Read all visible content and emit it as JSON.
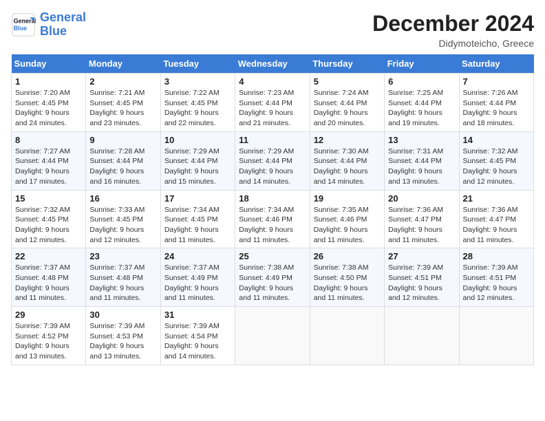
{
  "header": {
    "logo_line1": "General",
    "logo_line2": "Blue",
    "title": "December 2024",
    "subtitle": "Didymoteicho, Greece"
  },
  "weekdays": [
    "Sunday",
    "Monday",
    "Tuesday",
    "Wednesday",
    "Thursday",
    "Friday",
    "Saturday"
  ],
  "weeks": [
    [
      {
        "day": "1",
        "sunrise": "Sunrise: 7:20 AM",
        "sunset": "Sunset: 4:45 PM",
        "daylight": "Daylight: 9 hours and 24 minutes."
      },
      {
        "day": "2",
        "sunrise": "Sunrise: 7:21 AM",
        "sunset": "Sunset: 4:45 PM",
        "daylight": "Daylight: 9 hours and 23 minutes."
      },
      {
        "day": "3",
        "sunrise": "Sunrise: 7:22 AM",
        "sunset": "Sunset: 4:45 PM",
        "daylight": "Daylight: 9 hours and 22 minutes."
      },
      {
        "day": "4",
        "sunrise": "Sunrise: 7:23 AM",
        "sunset": "Sunset: 4:44 PM",
        "daylight": "Daylight: 9 hours and 21 minutes."
      },
      {
        "day": "5",
        "sunrise": "Sunrise: 7:24 AM",
        "sunset": "Sunset: 4:44 PM",
        "daylight": "Daylight: 9 hours and 20 minutes."
      },
      {
        "day": "6",
        "sunrise": "Sunrise: 7:25 AM",
        "sunset": "Sunset: 4:44 PM",
        "daylight": "Daylight: 9 hours and 19 minutes."
      },
      {
        "day": "7",
        "sunrise": "Sunrise: 7:26 AM",
        "sunset": "Sunset: 4:44 PM",
        "daylight": "Daylight: 9 hours and 18 minutes."
      }
    ],
    [
      {
        "day": "8",
        "sunrise": "Sunrise: 7:27 AM",
        "sunset": "Sunset: 4:44 PM",
        "daylight": "Daylight: 9 hours and 17 minutes."
      },
      {
        "day": "9",
        "sunrise": "Sunrise: 7:28 AM",
        "sunset": "Sunset: 4:44 PM",
        "daylight": "Daylight: 9 hours and 16 minutes."
      },
      {
        "day": "10",
        "sunrise": "Sunrise: 7:29 AM",
        "sunset": "Sunset: 4:44 PM",
        "daylight": "Daylight: 9 hours and 15 minutes."
      },
      {
        "day": "11",
        "sunrise": "Sunrise: 7:29 AM",
        "sunset": "Sunset: 4:44 PM",
        "daylight": "Daylight: 9 hours and 14 minutes."
      },
      {
        "day": "12",
        "sunrise": "Sunrise: 7:30 AM",
        "sunset": "Sunset: 4:44 PM",
        "daylight": "Daylight: 9 hours and 14 minutes."
      },
      {
        "day": "13",
        "sunrise": "Sunrise: 7:31 AM",
        "sunset": "Sunset: 4:44 PM",
        "daylight": "Daylight: 9 hours and 13 minutes."
      },
      {
        "day": "14",
        "sunrise": "Sunrise: 7:32 AM",
        "sunset": "Sunset: 4:45 PM",
        "daylight": "Daylight: 9 hours and 12 minutes."
      }
    ],
    [
      {
        "day": "15",
        "sunrise": "Sunrise: 7:32 AM",
        "sunset": "Sunset: 4:45 PM",
        "daylight": "Daylight: 9 hours and 12 minutes."
      },
      {
        "day": "16",
        "sunrise": "Sunrise: 7:33 AM",
        "sunset": "Sunset: 4:45 PM",
        "daylight": "Daylight: 9 hours and 12 minutes."
      },
      {
        "day": "17",
        "sunrise": "Sunrise: 7:34 AM",
        "sunset": "Sunset: 4:45 PM",
        "daylight": "Daylight: 9 hours and 11 minutes."
      },
      {
        "day": "18",
        "sunrise": "Sunrise: 7:34 AM",
        "sunset": "Sunset: 4:46 PM",
        "daylight": "Daylight: 9 hours and 11 minutes."
      },
      {
        "day": "19",
        "sunrise": "Sunrise: 7:35 AM",
        "sunset": "Sunset: 4:46 PM",
        "daylight": "Daylight: 9 hours and 11 minutes."
      },
      {
        "day": "20",
        "sunrise": "Sunrise: 7:36 AM",
        "sunset": "Sunset: 4:47 PM",
        "daylight": "Daylight: 9 hours and 11 minutes."
      },
      {
        "day": "21",
        "sunrise": "Sunrise: 7:36 AM",
        "sunset": "Sunset: 4:47 PM",
        "daylight": "Daylight: 9 hours and 11 minutes."
      }
    ],
    [
      {
        "day": "22",
        "sunrise": "Sunrise: 7:37 AM",
        "sunset": "Sunset: 4:48 PM",
        "daylight": "Daylight: 9 hours and 11 minutes."
      },
      {
        "day": "23",
        "sunrise": "Sunrise: 7:37 AM",
        "sunset": "Sunset: 4:48 PM",
        "daylight": "Daylight: 9 hours and 11 minutes."
      },
      {
        "day": "24",
        "sunrise": "Sunrise: 7:37 AM",
        "sunset": "Sunset: 4:49 PM",
        "daylight": "Daylight: 9 hours and 11 minutes."
      },
      {
        "day": "25",
        "sunrise": "Sunrise: 7:38 AM",
        "sunset": "Sunset: 4:49 PM",
        "daylight": "Daylight: 9 hours and 11 minutes."
      },
      {
        "day": "26",
        "sunrise": "Sunrise: 7:38 AM",
        "sunset": "Sunset: 4:50 PM",
        "daylight": "Daylight: 9 hours and 11 minutes."
      },
      {
        "day": "27",
        "sunrise": "Sunrise: 7:39 AM",
        "sunset": "Sunset: 4:51 PM",
        "daylight": "Daylight: 9 hours and 12 minutes."
      },
      {
        "day": "28",
        "sunrise": "Sunrise: 7:39 AM",
        "sunset": "Sunset: 4:51 PM",
        "daylight": "Daylight: 9 hours and 12 minutes."
      }
    ],
    [
      {
        "day": "29",
        "sunrise": "Sunrise: 7:39 AM",
        "sunset": "Sunset: 4:52 PM",
        "daylight": "Daylight: 9 hours and 13 minutes."
      },
      {
        "day": "30",
        "sunrise": "Sunrise: 7:39 AM",
        "sunset": "Sunset: 4:53 PM",
        "daylight": "Daylight: 9 hours and 13 minutes."
      },
      {
        "day": "31",
        "sunrise": "Sunrise: 7:39 AM",
        "sunset": "Sunset: 4:54 PM",
        "daylight": "Daylight: 9 hours and 14 minutes."
      },
      null,
      null,
      null,
      null
    ]
  ]
}
